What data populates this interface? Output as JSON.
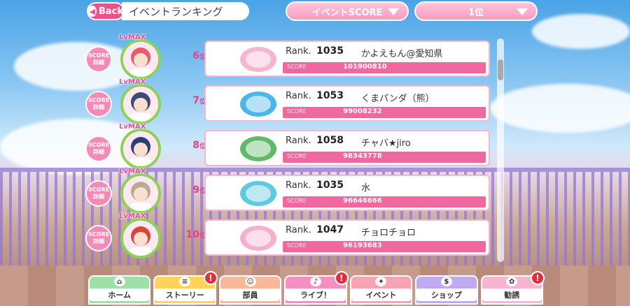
{
  "header": {
    "back_label": "Back",
    "title": "イベントランキング",
    "sort_dropdown": "イベントSCORE",
    "rank_dropdown": "1位"
  },
  "ranking": [
    {
      "position": "6",
      "position_suffix": "位",
      "lv_badge": "LvMAX",
      "detail_label": "SCORE詳細",
      "rank_label": "Rank.",
      "rank": "1035",
      "name": "かよえもん@愛知県",
      "score_label": "SCORE",
      "score": "101900810",
      "avatar_color": "#e95b6a",
      "emblem_color": "#f7b6d0"
    },
    {
      "position": "7",
      "position_suffix": "位",
      "lv_badge": "LvMAX",
      "detail_label": "SCORE詳細",
      "rank_label": "Rank.",
      "rank": "1053",
      "name": "くまパンダ（熊）",
      "score_label": "SCORE",
      "score": "99008232",
      "avatar_color": "#3a4a7a",
      "emblem_color": "#4db6e8"
    },
    {
      "position": "8",
      "position_suffix": "位",
      "lv_badge": "LvMAX",
      "detail_label": "SCORE詳細",
      "rank_label": "Rank.",
      "rank": "1058",
      "name": "チャバ★jiro",
      "score_label": "SCORE",
      "score": "98343778",
      "avatar_color": "#2c3e78",
      "emblem_color": "#63b86a"
    },
    {
      "position": "9",
      "position_suffix": "位",
      "lv_badge": "LvMAX",
      "detail_label": "SCORE詳細",
      "rank_label": "Rank.",
      "rank": "1035",
      "name": "水",
      "score_label": "SCORE",
      "score": "96646666",
      "avatar_color": "#b9aa95",
      "emblem_color": "#5ec9e0"
    },
    {
      "position": "10",
      "position_suffix": "位",
      "lv_badge": "LvMAX",
      "detail_label": "SCORE詳細",
      "rank_label": "Rank.",
      "rank": "1047",
      "name": "チョロチョロ",
      "score_label": "SCORE",
      "score": "96193683",
      "avatar_color": "#d9443f",
      "emblem_color": "#f5b0d0"
    }
  ],
  "nav": [
    {
      "label": "ホーム",
      "icon": "home-icon",
      "glyph": "⌂",
      "color": "#9fe0a8",
      "alert": false
    },
    {
      "label": "ストーリー",
      "icon": "story-icon",
      "glyph": "≡",
      "color": "#ffd35a",
      "alert": true
    },
    {
      "label": "部員",
      "icon": "members-icon",
      "glyph": "☺",
      "color": "#f7b999",
      "alert": false
    },
    {
      "label": "ライブ！",
      "icon": "live-icon",
      "glyph": "♪",
      "color": "#f58fc0",
      "alert": true
    },
    {
      "label": "イベント",
      "icon": "event-icon",
      "glyph": "✦",
      "color": "#f6a3b4",
      "alert": false
    },
    {
      "label": "ショップ",
      "icon": "shop-icon",
      "glyph": "$",
      "color": "#c2aaf0",
      "alert": false
    },
    {
      "label": "勧誘",
      "icon": "scout-icon",
      "glyph": "✿",
      "color": "#f7b6cf",
      "alert": true
    }
  ],
  "alert_glyph": "!"
}
